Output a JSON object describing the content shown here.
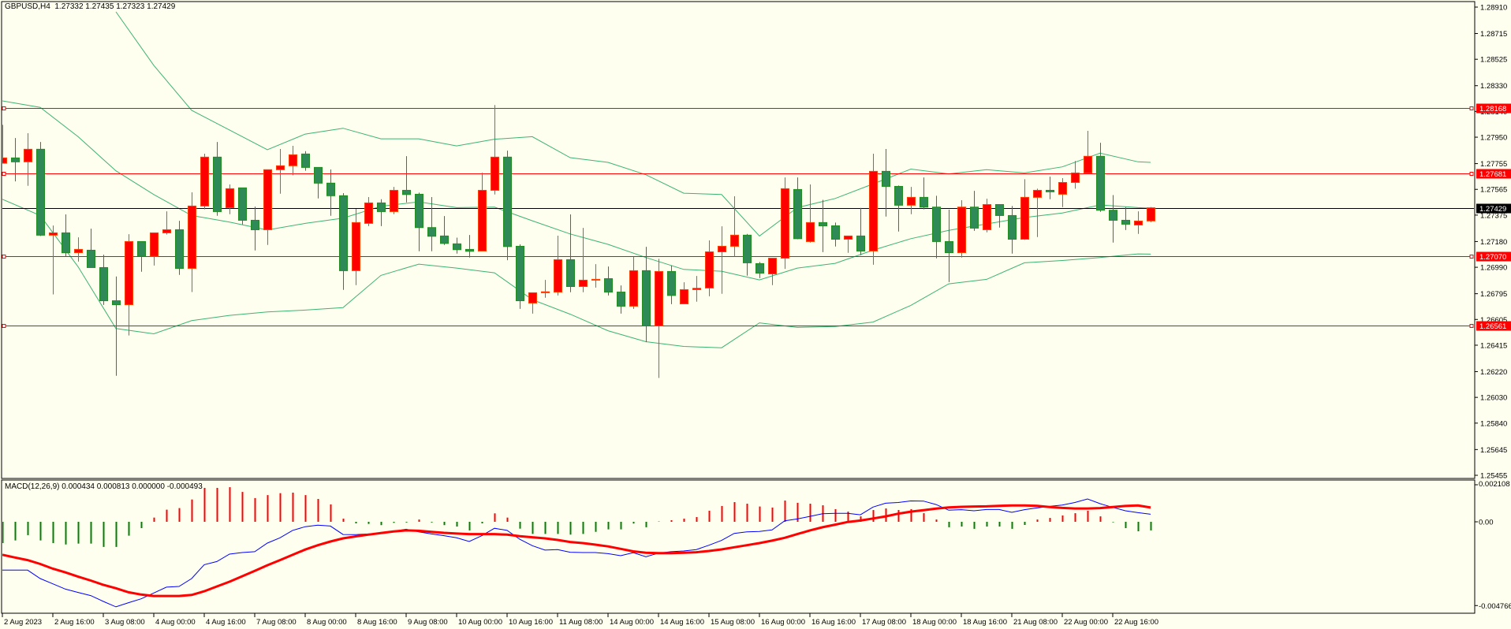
{
  "header": {
    "symbol_timeframe": "GBPUSD,H4",
    "ohlc_readout": "1.27332 1.27435 1.27323 1.27429"
  },
  "colors": {
    "background": "#fffff0",
    "bull_candle": "#ff0000",
    "bull_wick": "#ff4000",
    "bear_candle": "#2e8b57",
    "bear_border": "#228b22",
    "bands": "#3cb371",
    "level_line": "#ff0000",
    "current_price": "#000000",
    "macd_line": "#0000ff",
    "signal_line": "#ff0000",
    "hist_positive": "#ff0000",
    "hist_negative": "#008000"
  },
  "chart_data": [
    {
      "type": "candlestick",
      "title": "GBPUSD,H4",
      "ylim": [
        1.25455,
        1.2891
      ],
      "price_ticks": [
        "1.28910",
        "1.28715",
        "1.28525",
        "1.28330",
        "1.28140",
        "1.27950",
        "1.27755",
        "1.27565",
        "1.27375",
        "1.27180",
        "1.26990",
        "1.26795",
        "1.26605",
        "1.26415",
        "1.26220",
        "1.26030",
        "1.25840",
        "1.25645",
        "1.25455"
      ],
      "time_labels": [
        {
          "index": 0,
          "label": "2 Aug 2023"
        },
        {
          "index": 4,
          "label": "2 Aug 16:00"
        },
        {
          "index": 8,
          "label": "3 Aug 08:00"
        },
        {
          "index": 12,
          "label": "4 Aug 00:00"
        },
        {
          "index": 16,
          "label": "4 Aug 16:00"
        },
        {
          "index": 20,
          "label": "7 Aug 08:00"
        },
        {
          "index": 24,
          "label": "8 Aug 00:00"
        },
        {
          "index": 28,
          "label": "8 Aug 16:00"
        },
        {
          "index": 32,
          "label": "9 Aug 08:00"
        },
        {
          "index": 36,
          "label": "10 Aug 00:00"
        },
        {
          "index": 40,
          "label": "10 Aug 16:00"
        },
        {
          "index": 44,
          "label": "11 Aug 08:00"
        },
        {
          "index": 48,
          "label": "14 Aug 00:00"
        },
        {
          "index": 52,
          "label": "14 Aug 16:00"
        },
        {
          "index": 56,
          "label": "15 Aug 08:00"
        },
        {
          "index": 60,
          "label": "16 Aug 00:00"
        },
        {
          "index": 64,
          "label": "16 Aug 16:00"
        },
        {
          "index": 68,
          "label": "17 Aug 08:00"
        },
        {
          "index": 72,
          "label": "18 Aug 00:00"
        },
        {
          "index": 76,
          "label": "18 Aug 16:00"
        },
        {
          "index": 80,
          "label": "21 Aug 08:00"
        },
        {
          "index": 84,
          "label": "22 Aug 00:00"
        },
        {
          "index": 88,
          "label": "22 Aug 16:00"
        }
      ],
      "ohlc_fields": [
        "open",
        "high",
        "low",
        "close"
      ],
      "candles": [
        [
          1.27758,
          1.28041,
          1.27758,
          1.27797
        ],
        [
          1.27797,
          1.27944,
          1.27624,
          1.27768
        ],
        [
          1.27768,
          1.27979,
          1.27591,
          1.27861
        ],
        [
          1.27861,
          1.27915,
          1.27221,
          1.27227
        ],
        [
          1.27227,
          1.27298,
          1.2679,
          1.27244
        ],
        [
          1.27244,
          1.2738,
          1.27071,
          1.27097
        ],
        [
          1.27098,
          1.27211,
          1.27032,
          1.27122
        ],
        [
          1.27116,
          1.27275,
          1.26988,
          1.26988
        ],
        [
          1.26988,
          1.27083,
          1.26712,
          1.26743
        ],
        [
          1.26743,
          1.26922,
          1.26189,
          1.26714
        ],
        [
          1.26714,
          1.27234,
          1.26487,
          1.2718
        ],
        [
          1.2718,
          1.2718,
          1.26957,
          1.27071
        ],
        [
          1.27071,
          1.27244,
          1.27003,
          1.27244
        ],
        [
          1.27244,
          1.27403,
          1.27232,
          1.27267
        ],
        [
          1.27267,
          1.27333,
          1.26934,
          1.26982
        ],
        [
          1.26982,
          1.27543,
          1.26807,
          1.27442
        ],
        [
          1.27442,
          1.27828,
          1.27417,
          1.27803
        ],
        [
          1.27803,
          1.27915,
          1.2737,
          1.27401
        ],
        [
          1.2743,
          1.27601,
          1.27382,
          1.2757
        ],
        [
          1.27576,
          1.27576,
          1.27306,
          1.27337
        ],
        [
          1.27337,
          1.27438,
          1.27114,
          1.27267
        ],
        [
          1.27267,
          1.2771,
          1.27155,
          1.2771
        ],
        [
          1.2771,
          1.27863,
          1.27533,
          1.27739
        ],
        [
          1.27739,
          1.27886,
          1.27669,
          1.2782
        ],
        [
          1.27826,
          1.27847,
          1.27702,
          1.27727
        ],
        [
          1.27727,
          1.27727,
          1.27498,
          1.27611
        ],
        [
          1.27611,
          1.27712,
          1.2737,
          1.27518
        ],
        [
          1.27518,
          1.27537,
          1.26823,
          1.26965
        ],
        [
          1.26965,
          1.27421,
          1.26858,
          1.2732
        ],
        [
          1.27314,
          1.27508,
          1.27294,
          1.27465
        ],
        [
          1.27465,
          1.27492,
          1.27294,
          1.27401
        ],
        [
          1.27401,
          1.27583,
          1.27382,
          1.27558
        ],
        [
          1.27558,
          1.2781,
          1.27469,
          1.27527
        ],
        [
          1.27529,
          1.27541,
          1.27108,
          1.27283
        ],
        [
          1.27283,
          1.27508,
          1.27108,
          1.27219
        ],
        [
          1.27221,
          1.27368,
          1.27155,
          1.27166
        ],
        [
          1.27163,
          1.27209,
          1.27091,
          1.2712
        ],
        [
          1.27122,
          1.27228,
          1.27062,
          1.27108
        ],
        [
          1.2711,
          1.27688,
          1.2711,
          1.27558
        ],
        [
          1.27558,
          1.28187,
          1.27527,
          1.27803
        ],
        [
          1.27803,
          1.27851,
          1.27042,
          1.27143
        ],
        [
          1.27145,
          1.27159,
          1.26683,
          1.26743
        ],
        [
          1.26726,
          1.26802,
          1.26648,
          1.26802
        ],
        [
          1.26802,
          1.26897,
          1.26765,
          1.26809
        ],
        [
          1.26807,
          1.27223,
          1.26782,
          1.27046
        ],
        [
          1.27046,
          1.2738,
          1.26806,
          1.26848
        ],
        [
          1.26848,
          1.27281,
          1.26806,
          1.26895
        ],
        [
          1.26895,
          1.27013,
          1.2684,
          1.26901
        ],
        [
          1.26906,
          1.26996,
          1.26782,
          1.26807
        ],
        [
          1.26807,
          1.26856,
          1.26648,
          1.26703
        ],
        [
          1.26703,
          1.27067,
          1.26683,
          1.26965
        ],
        [
          1.26965,
          1.27141,
          1.26437,
          1.26557
        ],
        [
          1.26557,
          1.27052,
          1.26173,
          1.26959
        ],
        [
          1.26959,
          1.27003,
          1.26718,
          1.26782
        ],
        [
          1.2672,
          1.26879,
          1.2672,
          1.26825
        ],
        [
          1.26825,
          1.26926,
          1.26736,
          1.26835
        ],
        [
          1.26837,
          1.27188,
          1.26776,
          1.27104
        ],
        [
          1.27104,
          1.27292,
          1.26794,
          1.27145
        ],
        [
          1.27145,
          1.27514,
          1.27069,
          1.27227
        ],
        [
          1.27227,
          1.27236,
          1.26928,
          1.27023
        ],
        [
          1.27017,
          1.27029,
          1.2691,
          1.26947
        ],
        [
          1.26941,
          1.27057,
          1.26858,
          1.27057
        ],
        [
          1.27057,
          1.27653,
          1.26978,
          1.2757
        ],
        [
          1.27564,
          1.27653,
          1.27197,
          1.27201
        ],
        [
          1.2718,
          1.27601,
          1.27172,
          1.2732
        ],
        [
          1.2732,
          1.27488,
          1.27102,
          1.27296
        ],
        [
          1.27296,
          1.2732,
          1.27143,
          1.27197
        ],
        [
          1.27197,
          1.27221,
          1.27097,
          1.27221
        ],
        [
          1.27221,
          1.27428,
          1.27079,
          1.2711
        ],
        [
          1.2711,
          1.27828,
          1.27009,
          1.27698
        ],
        [
          1.27698,
          1.27863,
          1.27364,
          1.27587
        ],
        [
          1.27587,
          1.27593,
          1.27254,
          1.27448
        ],
        [
          1.27448,
          1.27583,
          1.27382,
          1.27506
        ],
        [
          1.27506,
          1.27653,
          1.27417,
          1.27434
        ],
        [
          1.27434,
          1.27518,
          1.27056,
          1.2718
        ],
        [
          1.2718,
          1.27415,
          1.26881,
          1.27098
        ],
        [
          1.27098,
          1.27485,
          1.27062,
          1.27434
        ],
        [
          1.27434,
          1.27554,
          1.27259,
          1.27279
        ],
        [
          1.27267,
          1.27496,
          1.27248,
          1.27453
        ],
        [
          1.27453,
          1.27453,
          1.27283,
          1.27372
        ],
        [
          1.27372,
          1.27442,
          1.27091,
          1.27197
        ],
        [
          1.27197,
          1.2764,
          1.27192,
          1.27506
        ],
        [
          1.27506,
          1.2757,
          1.27213,
          1.27558
        ],
        [
          1.27558,
          1.27659,
          1.27492,
          1.27547
        ],
        [
          1.27529,
          1.27648,
          1.27434,
          1.27616
        ],
        [
          1.27616,
          1.27774,
          1.2757,
          1.27686
        ],
        [
          1.27686,
          1.27997,
          1.27686,
          1.27809
        ],
        [
          1.27809,
          1.27909,
          1.27399,
          1.27411
        ],
        [
          1.27411,
          1.27523,
          1.27172,
          1.27337
        ],
        [
          1.27337,
          1.27434,
          1.27265,
          1.27308
        ],
        [
          1.27302,
          1.27403,
          1.27236,
          1.27331
        ],
        [
          1.27332,
          1.27435,
          1.27323,
          1.27429
        ]
      ],
      "bollinger": {
        "index": [
          0,
          3,
          6,
          9,
          12,
          15,
          18,
          21,
          24,
          27,
          30,
          33,
          36,
          39,
          42,
          45,
          48,
          51,
          54,
          57,
          60,
          63,
          66,
          69,
          72,
          75,
          78,
          81,
          84,
          87,
          90,
          91
        ],
        "upper": [
          null,
          null,
          null,
          1.28875,
          1.2848,
          1.28148,
          1.28003,
          1.27857,
          1.27973,
          1.28016,
          1.27938,
          1.27938,
          1.27886,
          1.27935,
          1.27954,
          1.27799,
          1.27764,
          1.27673,
          1.27537,
          1.27527,
          1.27221,
          1.2743,
          1.27498,
          1.27605,
          1.27715,
          1.27679,
          1.2771,
          1.27686,
          1.27731,
          1.27832,
          1.27768,
          1.27764
        ],
        "middle": [
          1.28218,
          1.2817,
          1.27954,
          1.27702,
          1.27527,
          1.27372,
          1.27324,
          1.27265,
          1.27314,
          1.27353,
          1.2744,
          1.27473,
          1.2743,
          1.27434,
          1.27333,
          1.27236,
          1.27159,
          1.27062,
          1.26974,
          1.26961,
          1.26897,
          1.26984,
          1.27019,
          1.27116,
          1.27201,
          1.27263,
          1.2731,
          1.27357,
          1.27391,
          1.2745,
          1.2743,
          1.27426
        ],
        "lower": [
          1.27492,
          1.27372,
          1.26994,
          1.26538,
          1.26499,
          1.26596,
          1.26635,
          1.2666,
          1.26674,
          1.26693,
          1.2693,
          1.27013,
          1.26984,
          1.26949,
          1.26751,
          1.26644,
          1.26522,
          1.26441,
          1.26406,
          1.26396,
          1.2658,
          1.26546,
          1.26553,
          1.26586,
          1.26709,
          1.26868,
          1.26901,
          1.27023,
          1.2704,
          1.27062,
          1.27089,
          1.27087
        ]
      },
      "levels": [
        {
          "price": 1.28168,
          "label": "1.28168"
        },
        {
          "price": 1.27681,
          "label": "1.27681"
        },
        {
          "price": 1.2707,
          "label": "1.27070"
        },
        {
          "price": 1.26561,
          "label": "1.26561"
        }
      ],
      "current_price": {
        "price": 1.27429,
        "label": "1.27429"
      }
    },
    {
      "type": "bar",
      "title": "MACD(12,26,9)",
      "values_readout": "0.000434 0.000813 0.000000 -0.000493",
      "ylim": [
        -0.004766,
        0.002108
      ],
      "y_ticks": [
        {
          "value": 0.002108,
          "label": "0.002108"
        },
        {
          "value": 0,
          "label": "0.00"
        },
        {
          "value": -0.004766,
          "label": "-0.004766"
        }
      ],
      "histogram": [
        -0.00121,
        -0.00106,
        -0.00076,
        -0.00106,
        -0.00121,
        -0.00129,
        -0.00124,
        -0.00124,
        -0.00143,
        -0.00143,
        -0.00079,
        -0.00036,
        0.00024,
        0.00069,
        0.00078,
        0.00127,
        0.00193,
        0.00193,
        0.00197,
        0.0017,
        0.00135,
        0.00152,
        0.00163,
        0.00166,
        0.00152,
        0.0013,
        0.00099,
        0.00018,
        -9e-05,
        -0.00012,
        -0.00019,
        -6e-05,
        -4e-05,
        0.00013,
        -4e-05,
        -0.00019,
        -0.00027,
        -0.00049,
        -9e-05,
        0.00048,
        0.00024,
        -0.00039,
        -0.00069,
        -0.00069,
        -0.00069,
        -0.00073,
        -0.00069,
        -0.00057,
        -0.00043,
        -0.00043,
        -0.0001,
        -0.00031,
        2e-05,
        9e-05,
        0.00018,
        0.00027,
        0.00063,
        0.0009,
        0.00112,
        0.00103,
        0.00087,
        0.00081,
        0.00121,
        0.00108,
        0.00103,
        0.00094,
        0.00072,
        0.00058,
        0.00031,
        0.00067,
        0.00076,
        0.00067,
        0.00072,
        0.00049,
        0.00013,
        -0.00031,
        -0.00027,
        -0.0004,
        -0.00027,
        -0.00027,
        -0.0004,
        -0.00018,
        0.00013,
        0.00022,
        0.00036,
        0.00049,
        0.00063,
        0.00031,
        -3e-05,
        -0.00036,
        -0.00054,
        -0.00049
      ],
      "macd": [
        -0.00275,
        -0.00275,
        -0.00275,
        -0.00323,
        -0.00353,
        -0.00383,
        -0.00402,
        -0.0042,
        -0.00453,
        -0.00484,
        -0.0046,
        -0.00438,
        -0.00405,
        -0.00372,
        -0.00368,
        -0.00323,
        -0.00244,
        -0.00226,
        -0.00184,
        -0.00175,
        -0.0017,
        -0.00121,
        -0.00091,
        -0.00049,
        -0.00028,
        -0.00019,
        -0.00024,
        -0.00072,
        -0.00073,
        -0.00069,
        -0.00066,
        -0.00054,
        -0.00042,
        -0.00057,
        -0.00069,
        -0.00079,
        -0.00091,
        -0.00112,
        -0.00079,
        -0.00037,
        -0.00049,
        -0.00099,
        -0.00136,
        -0.00161,
        -0.00158,
        -0.00173,
        -0.00175,
        -0.00175,
        -0.00181,
        -0.00193,
        -0.00176,
        -0.00199,
        -0.00178,
        -0.0017,
        -0.00166,
        -0.00158,
        -0.00133,
        -0.00106,
        -0.00066,
        -0.00057,
        -0.00055,
        -0.00046,
        6e-05,
        0.00016,
        0.00031,
        0.00046,
        0.00048,
        0.00048,
        0.0004,
        0.00084,
        0.00106,
        0.0011,
        0.00119,
        0.00118,
        0.00098,
        0.00066,
        0.00069,
        0.00063,
        0.0007,
        0.0007,
        0.00054,
        0.00069,
        0.00079,
        0.00088,
        0.00095,
        0.0011,
        0.0013,
        0.00103,
        0.00082,
        0.00063,
        0.00052,
        0.00043
      ],
      "signal": [
        -0.00188,
        -0.00203,
        -0.00218,
        -0.0024,
        -0.00267,
        -0.00288,
        -0.00312,
        -0.00334,
        -0.00359,
        -0.00378,
        -0.00401,
        -0.00414,
        -0.00422,
        -0.00422,
        -0.00422,
        -0.00416,
        -0.00395,
        -0.00368,
        -0.00341,
        -0.0031,
        -0.00279,
        -0.00247,
        -0.00218,
        -0.00188,
        -0.00158,
        -0.00133,
        -0.00112,
        -0.00094,
        -0.00083,
        -0.00073,
        -0.00064,
        -0.00055,
        -0.00049,
        -0.00051,
        -0.00057,
        -0.00063,
        -0.00067,
        -0.0007,
        -0.0007,
        -0.0007,
        -0.00073,
        -0.00082,
        -0.00088,
        -0.00094,
        -0.00103,
        -0.00115,
        -0.00121,
        -0.0013,
        -0.0014,
        -0.00154,
        -0.00168,
        -0.00176,
        -0.00178,
        -0.00178,
        -0.00176,
        -0.00173,
        -0.00166,
        -0.00157,
        -0.00145,
        -0.00133,
        -0.00121,
        -0.00107,
        -0.00091,
        -0.0007,
        -0.00049,
        -0.00031,
        -0.00016,
        -1e-05,
        7e-05,
        0.00019,
        0.00031,
        0.00046,
        0.00058,
        0.00066,
        0.00075,
        0.00082,
        0.00085,
        0.00087,
        0.00088,
        0.00091,
        0.00093,
        0.00093,
        0.00091,
        0.00084,
        0.00079,
        0.00076,
        0.00076,
        0.00078,
        0.00084,
        0.0009,
        0.00093,
        0.00081
      ]
    }
  ]
}
